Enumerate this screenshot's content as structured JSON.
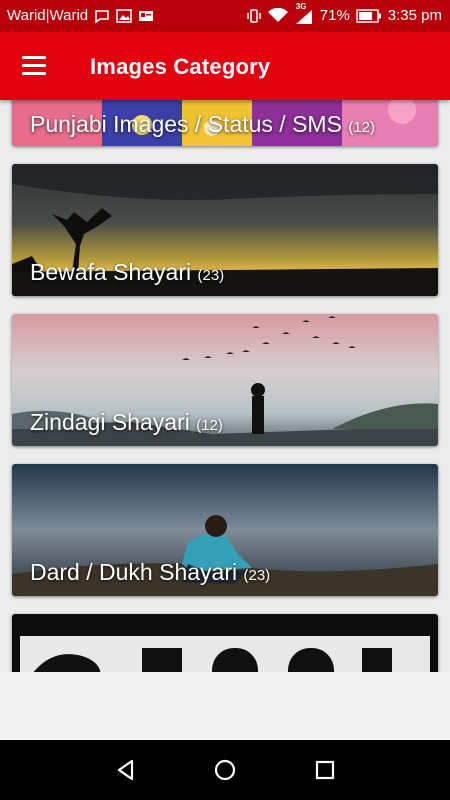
{
  "status": {
    "carrier": "Warid|Warid",
    "network": "3G",
    "battery": "71%",
    "time": "3:35 pm"
  },
  "appbar": {
    "title": "Images Category"
  },
  "categories": [
    {
      "label": "Punjabi Images / Status / SMS",
      "count": "(12)"
    },
    {
      "label": "Bewafa Shayari",
      "count": "(23)"
    },
    {
      "label": "Zindagi Shayari",
      "count": "(12)"
    },
    {
      "label": "Dard / Dukh Shayari",
      "count": "(23)"
    },
    {
      "label": "",
      "count": ""
    }
  ],
  "icons": {
    "menu": "menu-icon",
    "back": "back-icon",
    "home": "home-icon",
    "recents": "recents-icon"
  },
  "colors": {
    "appbar": "#e3000f",
    "statusbar": "#b8000b"
  }
}
